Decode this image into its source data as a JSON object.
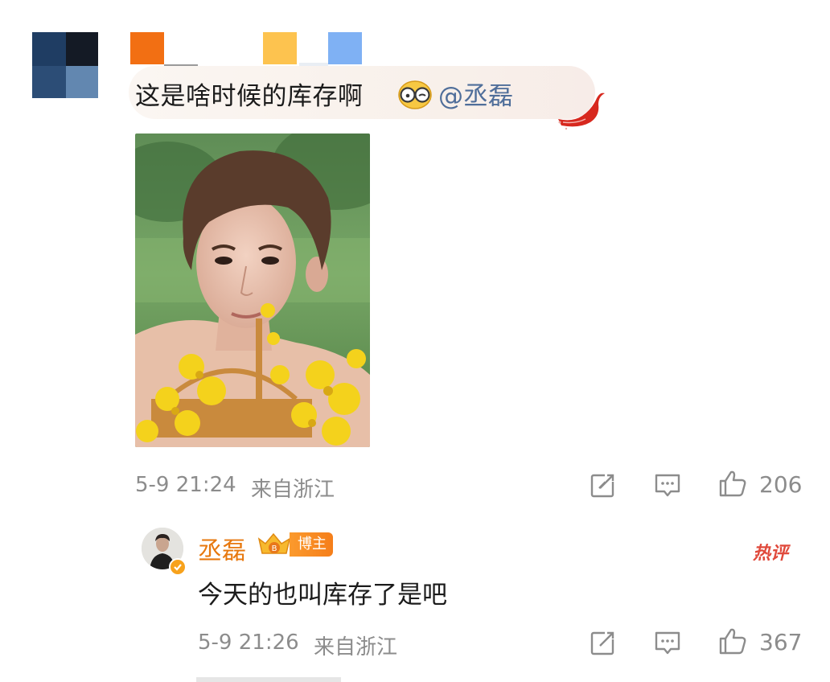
{
  "comment": {
    "text": "这是啥时候的库存啊",
    "mention": "@丞磊",
    "time": "5-9 21:24",
    "location": "来自浙江",
    "likes": "206"
  },
  "reply": {
    "username": "丞磊",
    "role_badge": "博主",
    "hot_label": "热评",
    "text": "今天的也叫库存了是吧",
    "time": "5-9 21:26",
    "location": "来自浙江",
    "likes": "367"
  },
  "icons": [
    "share-icon",
    "comment-icon",
    "like-icon",
    "wink-glasses-emoji",
    "verified-badge-icon",
    "crown-badge-icon"
  ],
  "colors": {
    "mention": "#4f6e9a",
    "username": "#e7780e",
    "hot": "#e04a3c",
    "meta": "#8c8c8c",
    "badge": "#f57e1a"
  }
}
